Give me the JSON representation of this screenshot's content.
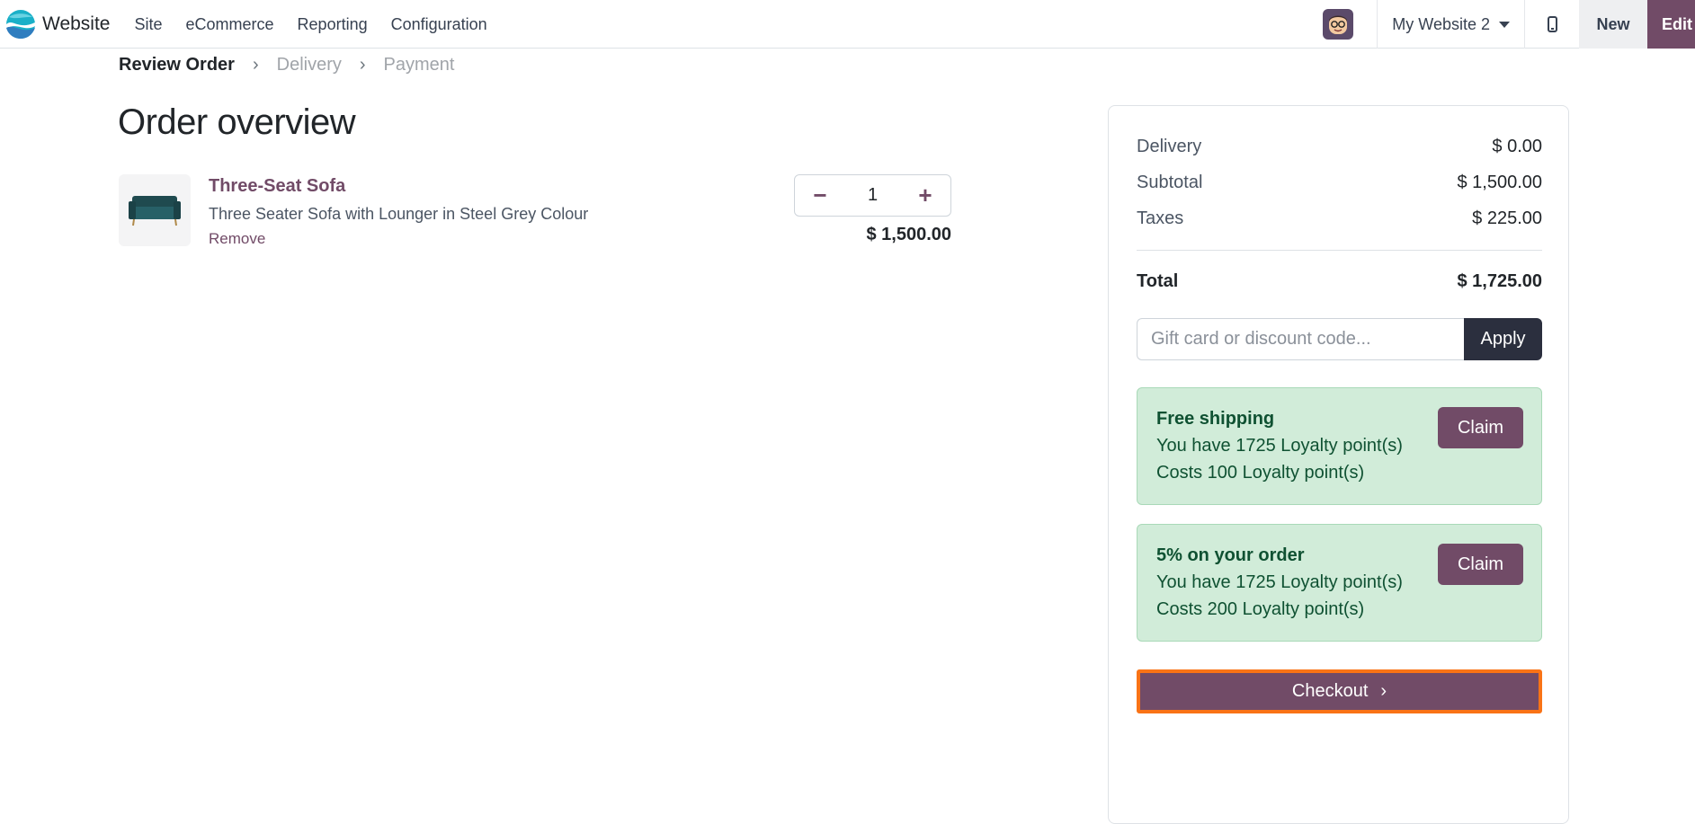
{
  "topbar": {
    "brand": "Website",
    "menu": [
      "Site",
      "eCommerce",
      "Reporting",
      "Configuration"
    ],
    "website_selector": "My Website 2",
    "new_label": "New",
    "edit_label": "Edit",
    "accent": "#714b67"
  },
  "breadcrumb": {
    "steps": [
      "Review Order",
      "Delivery",
      "Payment"
    ],
    "active_index": 0
  },
  "order": {
    "title": "Order overview",
    "product": {
      "name": "Three-Seat Sofa",
      "description": "Three Seater Sofa with Lounger in Steel Grey Colour",
      "remove_label": "Remove",
      "quantity": "1",
      "price": "$ 1,500.00"
    }
  },
  "summary": {
    "delivery_label": "Delivery",
    "delivery_value": "$ 0.00",
    "subtotal_label": "Subtotal",
    "subtotal_value": "$ 1,500.00",
    "taxes_label": "Taxes",
    "taxes_value": "$ 225.00",
    "total_label": "Total",
    "total_value": "$ 1,725.00",
    "coupon_placeholder": "Gift card or discount code...",
    "apply_label": "Apply",
    "rewards": [
      {
        "title": "Free shipping",
        "line1": "You have 1725 Loyalty point(s)",
        "line2": "Costs 100 Loyalty point(s)",
        "claim_label": "Claim"
      },
      {
        "title": "5% on your order",
        "line1": "You have 1725 Loyalty point(s)",
        "line2": "Costs 200 Loyalty point(s)",
        "claim_label": "Claim"
      }
    ],
    "checkout_label": "Checkout",
    "checkout_highlight": "#f97316"
  }
}
